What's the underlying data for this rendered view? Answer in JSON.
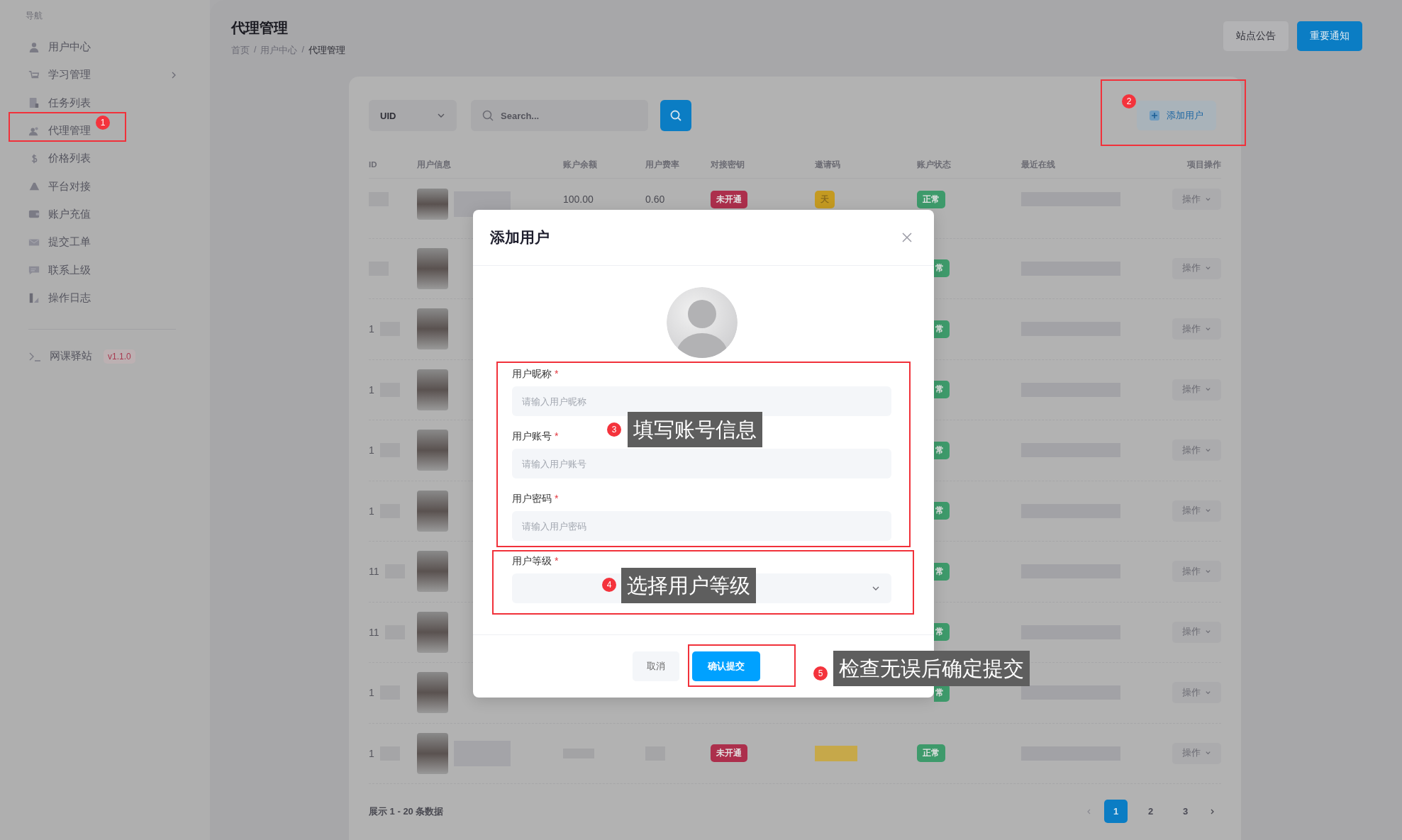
{
  "sidebar": {
    "heading": "导航",
    "items": [
      {
        "label": "用户中心",
        "expandable": false
      },
      {
        "label": "学习管理",
        "expandable": true
      },
      {
        "label": "任务列表",
        "expandable": false
      },
      {
        "label": "代理管理",
        "expandable": false
      },
      {
        "label": "价格列表",
        "expandable": false
      },
      {
        "label": "平台对接",
        "expandable": false
      },
      {
        "label": "账户充值",
        "expandable": false
      },
      {
        "label": "提交工单",
        "expandable": false
      },
      {
        "label": "联系上级",
        "expandable": false
      },
      {
        "label": "操作日志",
        "expandable": false
      }
    ],
    "footer": {
      "label": "网课驿站",
      "version": "v1.1.0"
    }
  },
  "header": {
    "title": "代理管理",
    "breadcrumb": [
      "首页",
      "用户中心",
      "代理管理"
    ],
    "breadcrumb_separator": "/",
    "buttons": [
      {
        "label": "站点公告",
        "kind": "secondary"
      },
      {
        "label": "重要通知",
        "kind": "primary"
      }
    ]
  },
  "toolbar": {
    "filter": "UID",
    "search": {
      "placeholder": "Search..."
    },
    "add_button": "添加用户"
  },
  "table": {
    "columns": [
      "ID",
      "用户信息",
      "账户余额",
      "用户费率",
      "对接密钥",
      "邀请码",
      "账户状态",
      "最近在线",
      "项目操作"
    ],
    "rows": [
      {
        "covered": false,
        "id": "",
        "balance": "100.00",
        "rate": "0.60",
        "key_tag": "未开通",
        "invite_tag": "天",
        "status": "正常",
        "action": "操作"
      },
      {
        "covered": true,
        "id": "",
        "status": "常",
        "action": "操作"
      },
      {
        "covered": true,
        "id": "1",
        "status": "常",
        "action": "操作"
      },
      {
        "covered": true,
        "id": "1",
        "status": "常",
        "action": "操作"
      },
      {
        "covered": true,
        "id": "1",
        "status": "常",
        "action": "操作"
      },
      {
        "covered": true,
        "id": "1",
        "status": "常",
        "action": "操作"
      },
      {
        "covered": true,
        "id": "11",
        "status": "常",
        "action": "操作"
      },
      {
        "covered": true,
        "id": "11",
        "status": "常",
        "action": "操作"
      },
      {
        "covered": true,
        "id": "1",
        "status": "常",
        "action": "操作"
      },
      {
        "covered": false,
        "id": "1",
        "balance": "",
        "rate": "",
        "key_tag": "未开通",
        "invite_tag": "",
        "status": "正常",
        "action": "操作"
      }
    ]
  },
  "footer": {
    "summary": "展示 1 - 20 条数据",
    "pages": [
      {
        "label": "1",
        "selected": true
      },
      {
        "label": "2",
        "selected": false
      },
      {
        "label": "3",
        "selected": false
      }
    ]
  },
  "dialog": {
    "title": "添加用户",
    "fields": [
      {
        "label": "用户昵称",
        "required_mark": "*",
        "kind": "input",
        "placeholder": "请输入用户昵称"
      },
      {
        "label": "用户账号",
        "required_mark": "*",
        "kind": "input",
        "placeholder": "请输入用户账号"
      },
      {
        "label": "用户密码",
        "required_mark": "*",
        "kind": "input",
        "placeholder": "请输入用户密码"
      },
      {
        "label": "用户等级",
        "required_mark": "*",
        "kind": "select"
      }
    ],
    "buttons": [
      {
        "label": "取消",
        "kind": "secondary"
      },
      {
        "label": "确认提交",
        "kind": "primary"
      }
    ]
  },
  "annotations": [
    {
      "number": "1"
    },
    {
      "number": "2"
    },
    {
      "number": "3",
      "callout": "填写账号信息"
    },
    {
      "number": "4",
      "callout": "选择用户等级"
    },
    {
      "number": "5",
      "callout": "检查无误后确定提交"
    }
  ]
}
